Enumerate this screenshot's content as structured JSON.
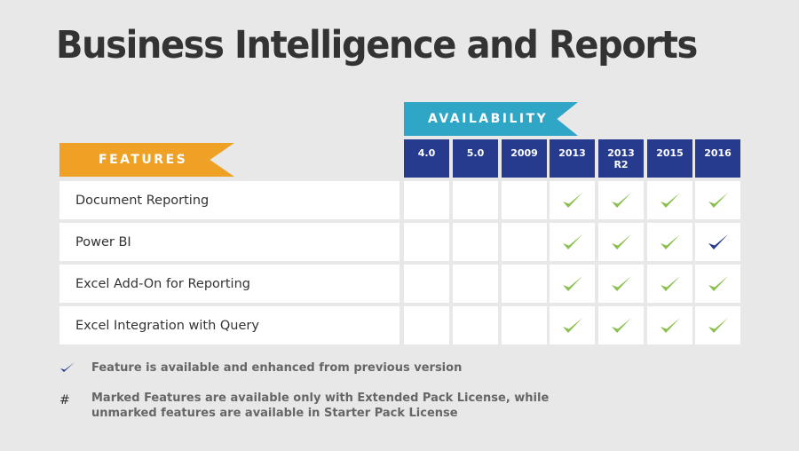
{
  "title": "Business Intelligence and Reports",
  "availability_label": "AVAILABILITY",
  "features_label": "FEATURES",
  "versions": [
    "4.0",
    "5.0",
    "2009",
    "2013",
    "2013 R2",
    "2015",
    "2016"
  ],
  "colors": {
    "check_available": "#8bbf4f",
    "check_enhanced": "#263b8e",
    "header_blue": "#263b8e",
    "availability_ribbon": "#30a6c7",
    "features_ribbon": "#eea125"
  },
  "features": [
    {
      "name": "Document Reporting",
      "availability": [
        "none",
        "none",
        "none",
        "available",
        "available",
        "available",
        "available"
      ]
    },
    {
      "name": "Power BI",
      "availability": [
        "none",
        "none",
        "none",
        "available",
        "available",
        "available",
        "enhanced"
      ]
    },
    {
      "name": "Excel Add-On for Reporting",
      "availability": [
        "none",
        "none",
        "none",
        "available",
        "available",
        "available",
        "available"
      ]
    },
    {
      "name": "Excel Integration with Query",
      "availability": [
        "none",
        "none",
        "none",
        "available",
        "available",
        "available",
        "available"
      ]
    }
  ],
  "legend": [
    {
      "icon": "check-icon-enhanced",
      "symbol": "✓",
      "text": "Feature is available and enhanced from previous version"
    },
    {
      "icon": "hash-icon",
      "symbol": "#",
      "text": "Marked Features are available only with Extended Pack License, while unmarked features are available in Starter Pack License"
    }
  ]
}
